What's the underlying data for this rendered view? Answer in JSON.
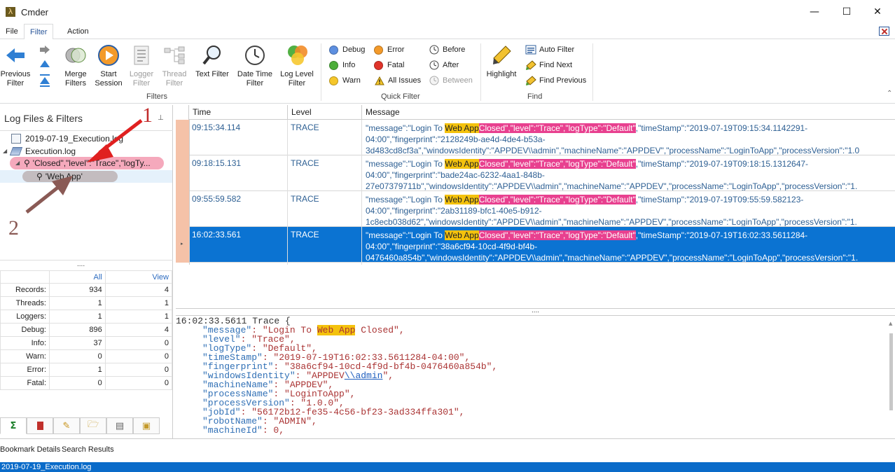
{
  "window": {
    "title": "Cmder",
    "minimize": "—",
    "maximize": "☐",
    "close": "✕"
  },
  "menu": {
    "file": "File",
    "filter": "Filter",
    "action": "Action"
  },
  "ribbon": {
    "previous_filter": [
      "Previous",
      "Filter"
    ],
    "merge_filters": [
      "Merge",
      "Filters"
    ],
    "start_session": [
      "Start",
      "Session"
    ],
    "logger_filter": [
      "Logger",
      "Filter"
    ],
    "thread_filter": [
      "Thread",
      "Filter"
    ],
    "text_filter": "Text Filter",
    "date_time_filter": [
      "Date Time",
      "Filter"
    ],
    "log_level_filter": [
      "Log Level",
      "Filter"
    ],
    "filters_group": "Filters",
    "quick": {
      "debug": "Debug",
      "info": "Info",
      "warn": "Warn",
      "error": "Error",
      "fatal": "Fatal",
      "all_issues": "All Issues",
      "before": "Before",
      "after": "After",
      "between": "Between"
    },
    "quick_group": "Quick Filter",
    "highlight": "Highlight",
    "auto_filter": "Auto Filter",
    "find_next": "Find Next",
    "find_previous": "Find Previous",
    "find_group": "Find"
  },
  "left_panel": {
    "title": "Log Files & Filters",
    "tree": [
      "2019-07-19_Execution.log",
      "Execution.log",
      "'Closed\",\"level\":\"Trace\",\"logTy...",
      "'Web App'"
    ],
    "stats_headers": [
      "All",
      "View"
    ],
    "stats": [
      {
        "label": "Records:",
        "all": "934",
        "view": "4"
      },
      {
        "label": "Threads:",
        "all": "1",
        "view": "1"
      },
      {
        "label": "Loggers:",
        "all": "1",
        "view": "1"
      },
      {
        "label": "Debug:",
        "all": "896",
        "view": "4"
      },
      {
        "label": "Info:",
        "all": "37",
        "view": "0"
      },
      {
        "label": "Warn:",
        "all": "0",
        "view": "0"
      },
      {
        "label": "Error:",
        "all": "1",
        "view": "0"
      },
      {
        "label": "Fatal:",
        "all": "0",
        "view": "0"
      }
    ],
    "tab_icons": [
      "sigma",
      "bookmark",
      "pencil",
      "folder-search",
      "database",
      "note"
    ]
  },
  "annotations": {
    "one": "1",
    "two": "2"
  },
  "grid": {
    "columns": [
      "Time",
      "Level",
      "Message"
    ],
    "rows": [
      {
        "time": "09:15:34.114",
        "level": "TRACE",
        "pre": "\"message\":\"Login To ",
        "h1": "Web App",
        "h2": "Closed\",\"level\":\"Trace\",\"logType\":\"Default\"",
        "post": ",\"timeStamp\":\"2019-07-19T09:15:34.1142291-",
        "line2": "04:00\",\"fingerprint\":\"2128249b-ae4d-4de4-b53a-",
        "line3": "3d483cd8cf3a\",\"windowsIdentity\":\"APPDEV\\\\admin\",\"machineName\":\"APPDEV\",\"processName\":\"LoginToApp\",\"processVersion\":\"1.0"
      },
      {
        "time": "09:18:15.131",
        "level": "TRACE",
        "pre": "\"message\":\"Login To ",
        "h1": "Web App",
        "h2": "Closed\",\"level\":\"Trace\",\"logType\":\"Default\"",
        "post": ",\"timeStamp\":\"2019-07-19T09:18:15.1312647-",
        "line2": "04:00\",\"fingerprint\":\"bade24ac-6232-4aa1-848b-",
        "line3": "27e07379711b\",\"windowsIdentity\":\"APPDEV\\\\admin\",\"machineName\":\"APPDEV\",\"processName\":\"LoginToApp\",\"processVersion\":\"1."
      },
      {
        "time": "09:55:59.582",
        "level": "TRACE",
        "pre": "\"message\":\"Login To ",
        "h1": "Web App",
        "h2": "Closed\",\"level\":\"Trace\",\"logType\":\"Default\"",
        "post": ",\"timeStamp\":\"2019-07-19T09:55:59.582123-",
        "line2": "04:00\",\"fingerprint\":\"2ab31189-bfc1-40e5-b912-",
        "line3": "1c8ecb038d62\",\"windowsIdentity\":\"APPDEV\\\\admin\",\"machineName\":\"APPDEV\",\"processName\":\"LoginToApp\",\"processVersion\":\"1."
      },
      {
        "time": "16:02:33.561",
        "level": "TRACE",
        "pre": "\"message\":\"Login To ",
        "h1": "Web App",
        "h2": "Closed\",\"level\":\"Trace\",\"logType\":\"Default\"",
        "post": ",\"timeStamp\":\"2019-07-19T16:02:33.5611284-",
        "line2": "04:00\",\"fingerprint\":\"38a6cf94-10cd-4f9d-bf4b-",
        "line3": "0476460a854b\",\"windowsIdentity\":\"APPDEV\\\\admin\",\"machineName\":\"APPDEV\",\"processName\":\"LoginToApp\",\"processVersion\":\"1."
      }
    ]
  },
  "splitter": "....",
  "detail": {
    "header": "16:02:33.5611 Trace {",
    "msg_key": "\"message\"",
    "msg_pre": ": \"Login To ",
    "msg_hl": "Web App",
    "msg_post": " Closed\",",
    "fields": [
      {
        "k": "\"level\"",
        "v": ": \"Trace\","
      },
      {
        "k": "\"logType\"",
        "v": ": \"Default\","
      },
      {
        "k": "\"timeStamp\"",
        "v": ": \"2019-07-19T16:02:33.5611284-04:00\","
      },
      {
        "k": "\"fingerprint\"",
        "v": ": \"38a6cf94-10cd-4f9d-bf4b-0476460a854b\","
      },
      {
        "k": "\"windowsIdentity\"",
        "v": ": \"APPDEV",
        "link": "\\\\admin",
        "v2": "\","
      },
      {
        "k": "\"machineName\"",
        "v": ": \"APPDEV\","
      },
      {
        "k": "\"processName\"",
        "v": ": \"LoginToApp\","
      },
      {
        "k": "\"processVersion\"",
        "v": ": \"1.0.0\","
      },
      {
        "k": "\"jobId\"",
        "v": ": \"56172b12-fe35-4c56-bf23-3ad334ffa301\","
      },
      {
        "k": "\"robotName\"",
        "v": ": \"ADMIN\","
      },
      {
        "k": "\"machineId\"",
        "v": ": 0,"
      }
    ]
  },
  "status_tabs": {
    "bookmark_details": "Bookmark Details",
    "search_results": "Search Results"
  },
  "status_bar": "2019-07-19_Execution.log"
}
